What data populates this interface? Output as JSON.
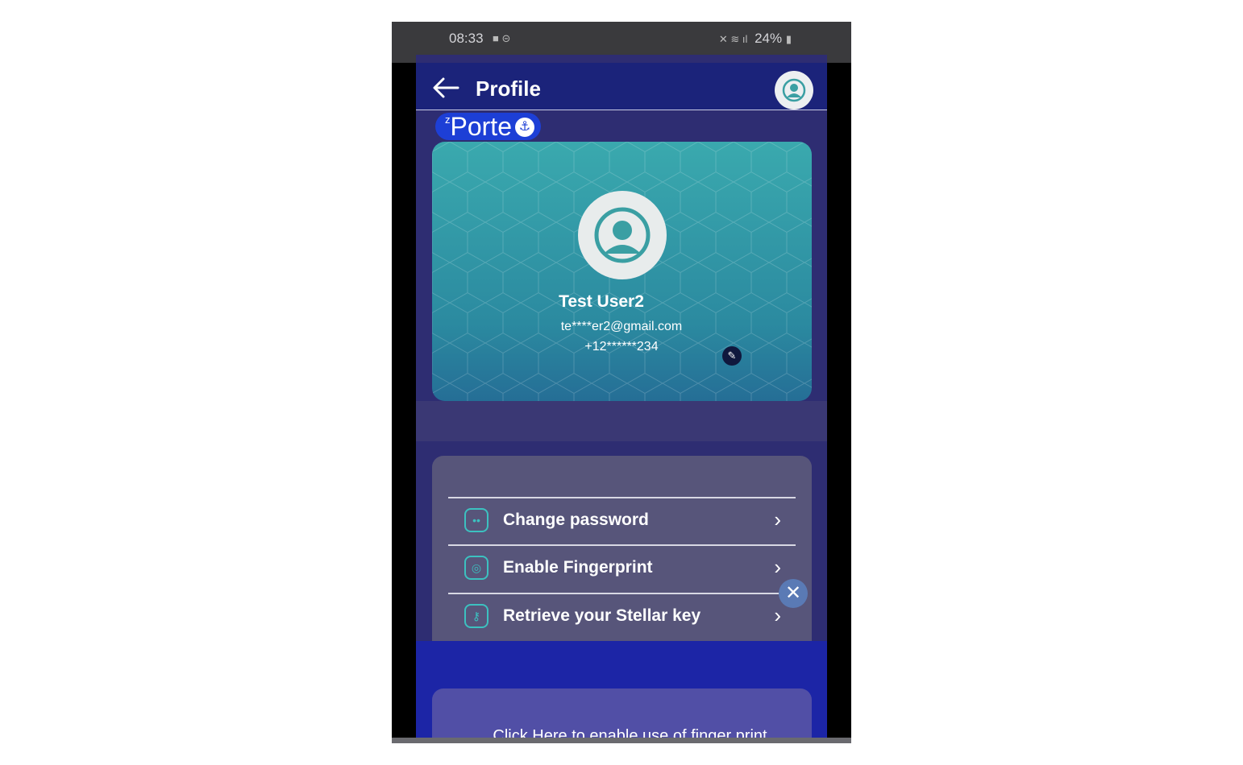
{
  "status_bar": {
    "time": "08:33",
    "battery": "24%"
  },
  "header": {
    "title": "Profile",
    "back_icon": "arrow-left-icon",
    "profile_icon": "user-circle-icon"
  },
  "logo": {
    "superscript": "z",
    "text": "Porte",
    "icon": "anchor-icon"
  },
  "profile_card": {
    "name": "Test User2",
    "email": "te****er2@gmail.com",
    "phone": "+12******234",
    "edit_icon": "pencil-icon"
  },
  "settings": {
    "items": [
      {
        "label": "Change password",
        "icon": "password-icon"
      },
      {
        "label": "Enable Fingerprint",
        "icon": "fingerprint-icon"
      },
      {
        "label": "Retrieve your Stellar key",
        "icon": "key-icon"
      }
    ]
  },
  "close_button": {
    "glyph": "✕"
  },
  "fingerprint_prompt": {
    "text": "Click Here to enable use of finger print"
  },
  "colors": {
    "header_bg": "#1b237a",
    "card_accent": "#3aa9ae",
    "icon_accent": "#3cc1c0",
    "prompt_bg": "#514fa6"
  }
}
